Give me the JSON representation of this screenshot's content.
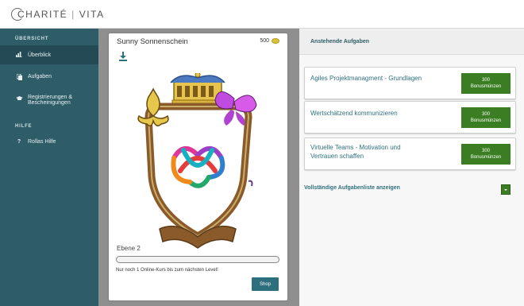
{
  "header": {
    "logo_left": "CHARITÉ",
    "logo_sep": "|",
    "logo_right": "VITA"
  },
  "sidebar": {
    "section1": "ÜBERSICHT",
    "items": [
      {
        "label": "Überblick",
        "icon": "bar-chart-icon"
      },
      {
        "label": "Aufgaben",
        "icon": "copy-icon"
      },
      {
        "label": "Registrierungen &",
        "label2": "Bescheinigungen",
        "icon": "graduation-cap-icon"
      }
    ],
    "section2": "HILFE",
    "help": {
      "label": "Rollas Hilfe",
      "icon": "question-icon"
    }
  },
  "profile": {
    "name": "Sunny Sonnenschein",
    "coins": "500",
    "level": "Ebene 2",
    "progress": 0,
    "next_level_text": "Nur noch 1 Online-Kurs bis zum nächsten Level!",
    "shop_label": "Shop"
  },
  "tasks": {
    "title": "Anstehende Aufgaben",
    "items": [
      {
        "line1": "Agiles Projektmanagment - Grundlagen",
        "line2": "",
        "points": "300",
        "unit": "Bonusmünzen"
      },
      {
        "line1": "Wertschätzend kommunizieren",
        "line2": "",
        "points": "300",
        "unit": "Bonusmünzen"
      },
      {
        "line1": "Virtuelle Teams - Motivation und",
        "line2": "Vertrauen schaffen",
        "points": "300",
        "unit": "Bonusmünzen"
      }
    ],
    "full_list_label": "Vollständige Aufgabenliste anzeigen"
  },
  "colors": {
    "sidebar": "#2e5d68",
    "accent": "#2e6f7d",
    "badge": "#3a7d22"
  }
}
